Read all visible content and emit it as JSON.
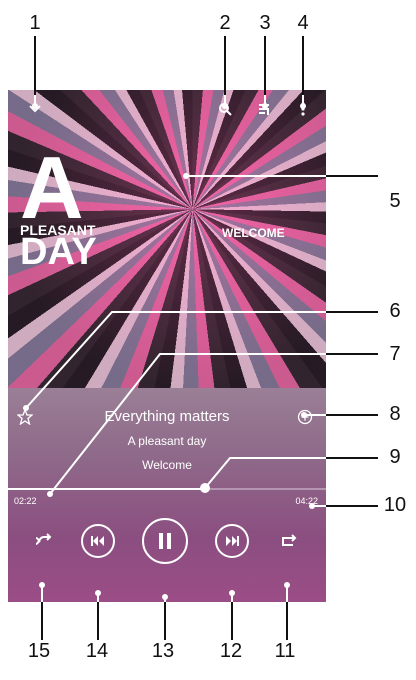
{
  "song": {
    "title": "Everything matters",
    "album": "A pleasant day",
    "artist": "Welcome"
  },
  "artwork": {
    "line1": "A",
    "line2": "PLEASANT",
    "line3": "DAY",
    "tag": "WELCOME"
  },
  "progress": {
    "elapsed": "02:22",
    "total": "04:22",
    "fraction": 0.62
  },
  "icons": {
    "collapse": "chevron-down-icon",
    "search": "search-icon",
    "queue": "queue-icon",
    "more": "more-vert-icon",
    "favorite": "star-icon",
    "add": "add-circle-icon",
    "shuffle": "shuffle-icon",
    "previous": "previous-icon",
    "play_pause": "pause-icon",
    "next": "next-icon",
    "repeat": "repeat-icon"
  },
  "callouts": {
    "c1": "1",
    "c2": "2",
    "c3": "3",
    "c4": "4",
    "c5": "5",
    "c6": "6",
    "c7": "7",
    "c8": "8",
    "c9": "9",
    "c10": "10",
    "c11": "11",
    "c12": "12",
    "c13": "13",
    "c14": "14",
    "c15": "15"
  }
}
